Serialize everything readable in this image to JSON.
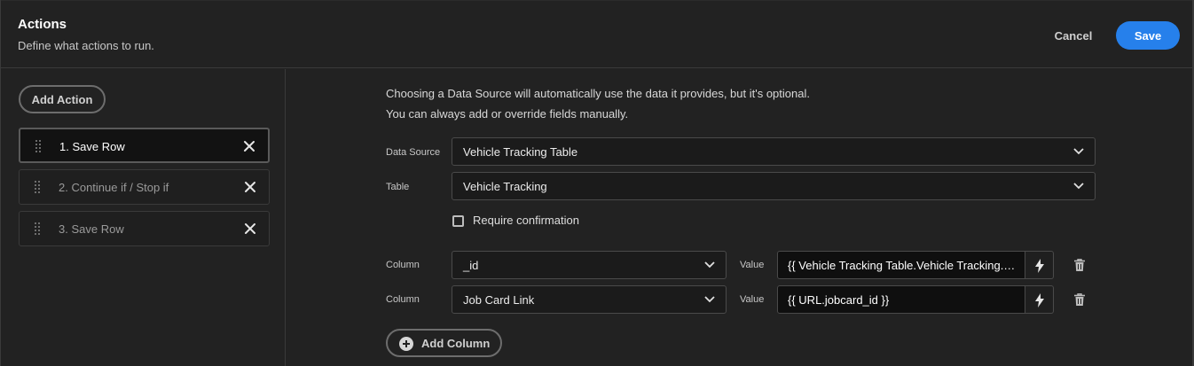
{
  "header": {
    "title": "Actions",
    "subtitle": "Define what actions to run.",
    "cancel_label": "Cancel",
    "save_label": "Save"
  },
  "sidebar": {
    "add_action_label": "Add Action",
    "actions": [
      {
        "label": "1. Save Row",
        "selected": true
      },
      {
        "label": "2. Continue if / Stop if",
        "selected": false
      },
      {
        "label": "3. Save Row",
        "selected": false
      }
    ]
  },
  "main": {
    "info_line_1": "Choosing a Data Source will automatically use the data it provides, but it's optional.",
    "info_line_2": "You can always add or override fields manually.",
    "data_source_label": "Data Source",
    "data_source_value": "Vehicle Tracking Table",
    "table_label": "Table",
    "table_value": "Vehicle Tracking",
    "require_confirmation_label": "Require confirmation",
    "require_confirmation_checked": false,
    "columns": [
      {
        "column_label": "Column",
        "column_value": "_id",
        "value_label": "Value",
        "value_text": "{{ Vehicle Tracking Table.Vehicle Tracking.…"
      },
      {
        "column_label": "Column",
        "column_value": "Job Card Link",
        "value_label": "Value",
        "value_text": "{{ URL.jobcard_id }}"
      }
    ],
    "add_column_label": "Add Column"
  },
  "icons": {
    "drag": "drag-handle-icon",
    "remove": "close-icon",
    "dropdown": "chevron-down-icon",
    "binding": "lightning-icon",
    "delete": "trash-icon",
    "add": "plus-circle-icon"
  },
  "colors": {
    "accent": "#2680eb",
    "background": "#222222"
  }
}
